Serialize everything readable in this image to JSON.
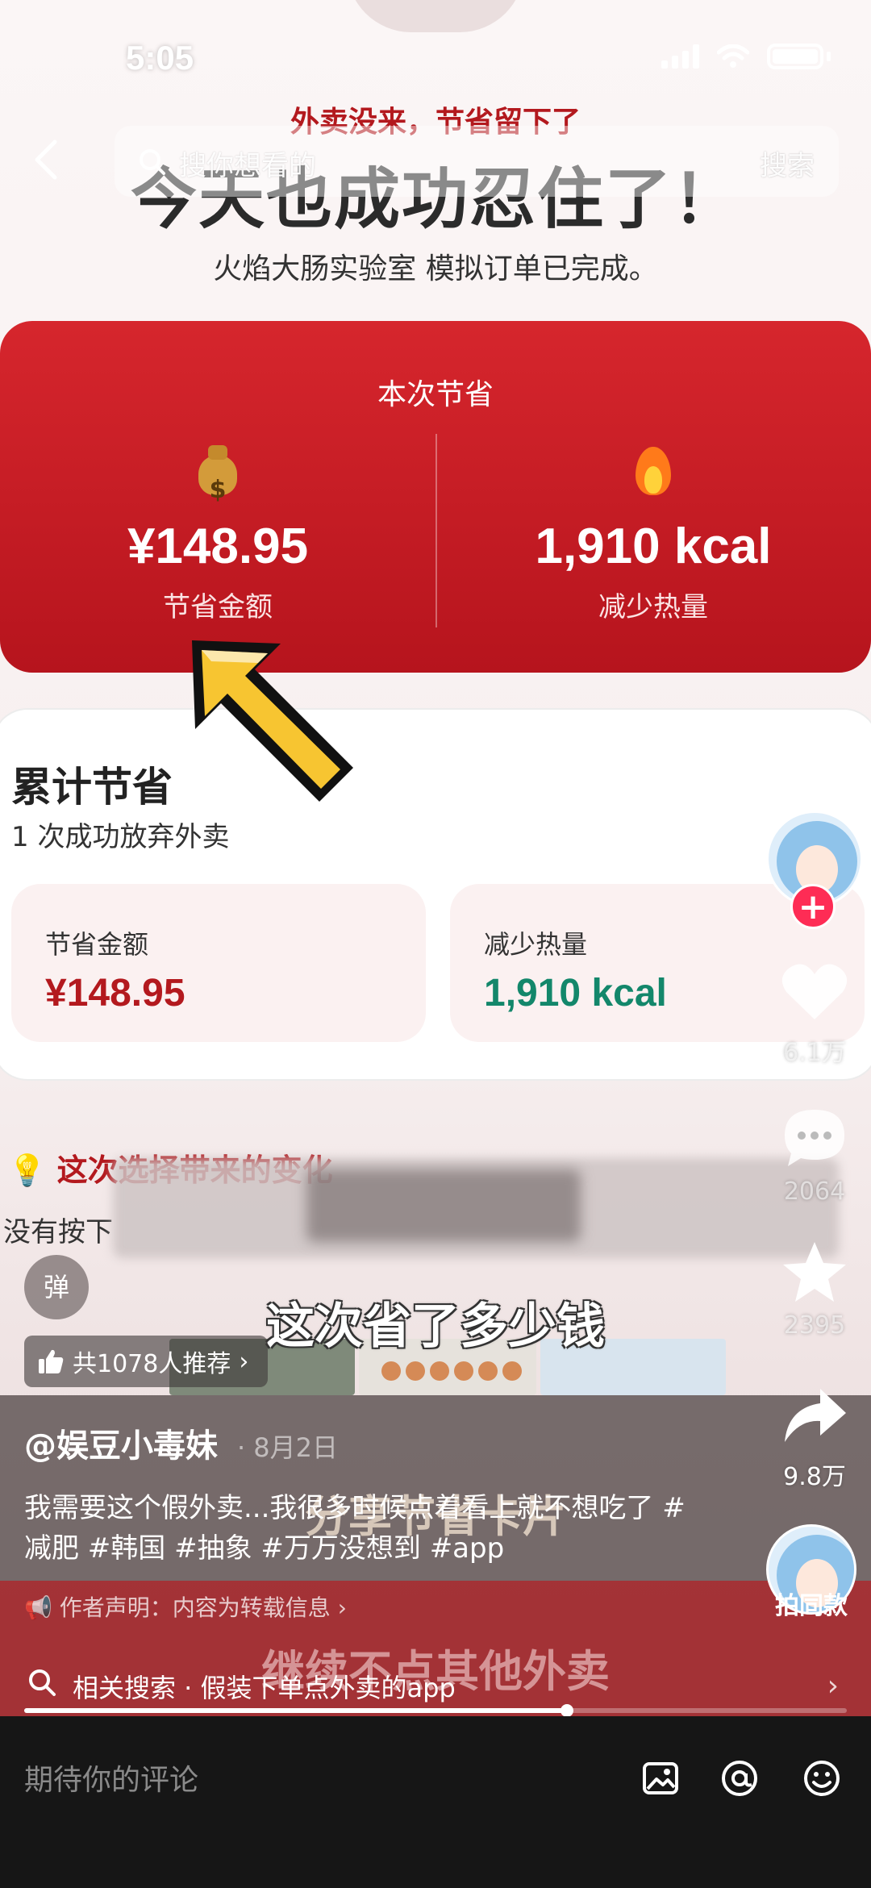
{
  "status_bar": {
    "time": "5:05"
  },
  "search": {
    "placeholder": "搜你想看的",
    "button": "搜索"
  },
  "banner": {
    "subtitle": "外卖没来，节省留下了",
    "headline": "今天也成功忍住了！",
    "note": "火焰大肠实验室 模拟订单已完成。"
  },
  "current_savings": {
    "title": "本次节省",
    "money_value": "¥148.95",
    "money_label": "节省金额",
    "money_icon": "money-bag-icon",
    "calorie_value": "1,910 kcal",
    "calorie_label": "减少热量",
    "calorie_icon": "fire-icon"
  },
  "cumulative": {
    "title": "累计节省",
    "subtitle": "1 次成功放弃外卖",
    "money_label": "节省金额",
    "money_value": "¥148.95",
    "money_color": "#b3191e",
    "calorie_label": "减少热量",
    "calorie_value": "1,910 kcal",
    "calorie_color": "#13876b"
  },
  "tip": {
    "title": "这次选择带来的变化",
    "text": "没有按下"
  },
  "video_overlay": {
    "danmaku_button": "弹",
    "subtitle_top": "这次省了多少钱",
    "recommend": "共1078人推荐",
    "author": "@娱豆小毒妹",
    "date": "· 8月2日",
    "description": "我需要这个假外卖...我很多时候点着看上就不想吃了 #减肥 #韩国 #抽象 #万万没想到 #app",
    "caption_middle": "分享节省卡片",
    "disclaimer": "作者声明：内容为转载信息",
    "caption_bottom": "继续不点其他外卖",
    "related_search": "相关搜索 · 假装下单点外卖的app",
    "progress": 0.66
  },
  "right_rail": {
    "likes": "6.1万",
    "comments": "2064",
    "favorites": "2395",
    "shares": "9.8万",
    "same_style": "拍同款"
  },
  "comment_bar": {
    "placeholder": "期待你的评论"
  }
}
